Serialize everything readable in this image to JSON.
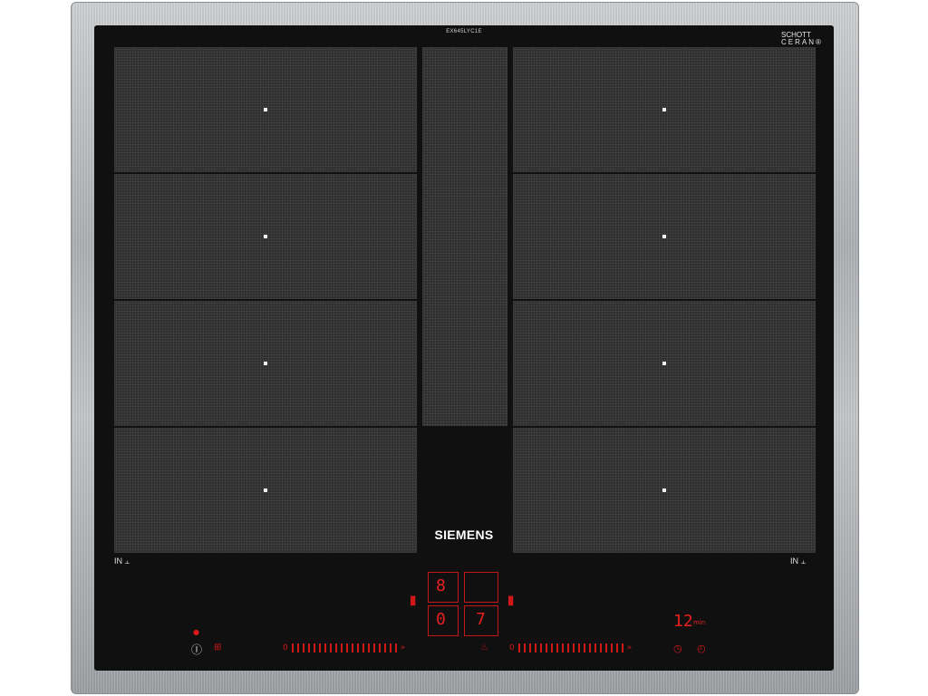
{
  "hob": {
    "model_label": "EX645LYC1E",
    "schott_logo": "SCHOTT",
    "ceran_logo": "CERAN®",
    "brand": "SIEMENS",
    "left_zone_label": "IN",
    "right_zone_label": "IN"
  },
  "controls": {
    "left_power_level": "8",
    "left_indicator_0": "0",
    "right_power_level": "7",
    "timer_value": "12",
    "timer_unit": "min"
  },
  "colors": {
    "display_red": "#e62020",
    "glass_black": "#101010",
    "zone_grey": "#2f2f2f",
    "frame_steel": "#b6b8ba"
  },
  "icons": {
    "power": "power-icon",
    "child_lock": "lock-icon",
    "pan": "pan-icon",
    "timer": "timer-icon",
    "stopwatch": "stopwatch-icon"
  }
}
